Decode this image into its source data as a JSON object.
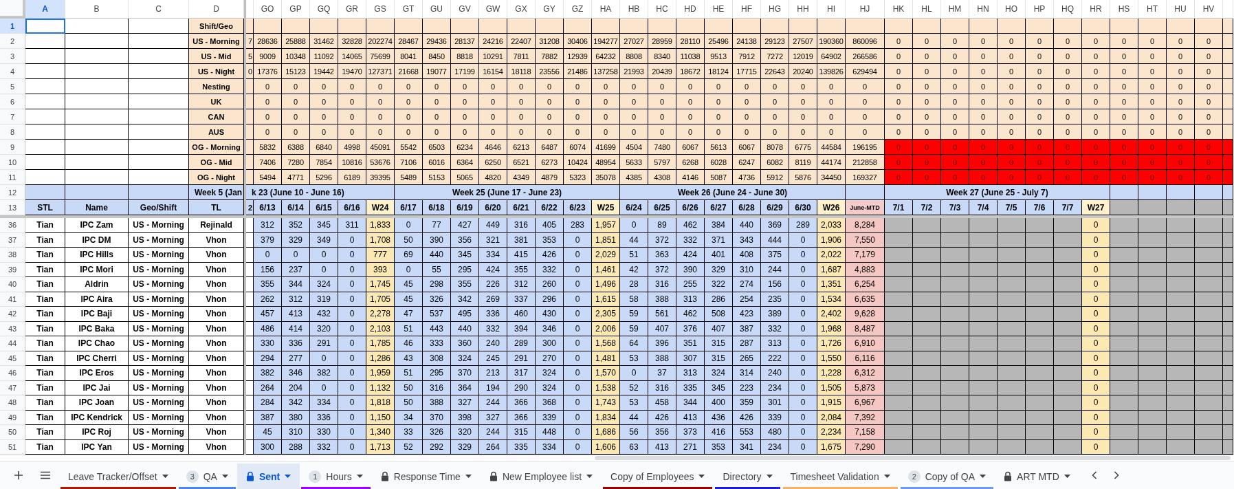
{
  "column_headers": [
    {
      "label": "A",
      "selected": true
    },
    {
      "label": "B",
      "selected": false
    },
    {
      "label": "C",
      "selected": false
    },
    {
      "label": "D",
      "selected": false
    },
    {
      "label": "GO",
      "selected": false
    },
    {
      "label": "GP",
      "selected": false
    },
    {
      "label": "GQ",
      "selected": false
    },
    {
      "label": "GR",
      "selected": false
    },
    {
      "label": "GS",
      "selected": false
    },
    {
      "label": "GT",
      "selected": false
    },
    {
      "label": "GU",
      "selected": false
    },
    {
      "label": "GV",
      "selected": false
    },
    {
      "label": "GW",
      "selected": false
    },
    {
      "label": "GX",
      "selected": false
    },
    {
      "label": "GY",
      "selected": false
    },
    {
      "label": "GZ",
      "selected": false
    },
    {
      "label": "HA",
      "selected": false
    },
    {
      "label": "HB",
      "selected": false
    },
    {
      "label": "HC",
      "selected": false
    },
    {
      "label": "HD",
      "selected": false
    },
    {
      "label": "HE",
      "selected": false
    },
    {
      "label": "HF",
      "selected": false
    },
    {
      "label": "HG",
      "selected": false
    },
    {
      "label": "HH",
      "selected": false
    },
    {
      "label": "HI",
      "selected": false
    },
    {
      "label": "HJ",
      "selected": false
    },
    {
      "label": "HK",
      "selected": false
    },
    {
      "label": "HL",
      "selected": false
    },
    {
      "label": "HM",
      "selected": false
    },
    {
      "label": "HN",
      "selected": false
    },
    {
      "label": "HO",
      "selected": false
    },
    {
      "label": "HP",
      "selected": false
    },
    {
      "label": "HQ",
      "selected": false
    },
    {
      "label": "HR",
      "selected": false
    },
    {
      "label": "HS",
      "selected": false
    },
    {
      "label": "HT",
      "selected": false
    },
    {
      "label": "HU",
      "selected": false
    },
    {
      "label": "HV",
      "selected": false
    }
  ],
  "summary_rows": [
    {
      "number": "1",
      "selected": true,
      "label": "Shift/Geo",
      "flagged": false
    },
    {
      "number": "2",
      "selected": false,
      "label": "US - Morning",
      "cut": "7",
      "flagged": false,
      "values": [
        "28636",
        "25888",
        "31462",
        "32828",
        "202274",
        "28467",
        "29436",
        "28137",
        "24216",
        "22407",
        "31208",
        "30406",
        "194277",
        "27027",
        "28959",
        "28110",
        "25496",
        "24138",
        "29123",
        "27507",
        "190360",
        "860096"
      ],
      "next": [
        "0",
        "0",
        "0",
        "0",
        "0",
        "0",
        "0",
        "0",
        "0",
        "0",
        "0",
        "0"
      ]
    },
    {
      "number": "3",
      "selected": false,
      "label": "US - Mid",
      "cut": "5",
      "flagged": false,
      "values": [
        "9009",
        "10348",
        "11092",
        "14065",
        "75699",
        "8041",
        "8450",
        "8818",
        "10291",
        "7811",
        "7882",
        "12939",
        "64232",
        "8808",
        "8340",
        "11038",
        "9513",
        "7912",
        "7272",
        "12019",
        "64902",
        "266586"
      ],
      "next": [
        "0",
        "0",
        "0",
        "0",
        "0",
        "0",
        "0",
        "0",
        "0",
        "0",
        "0",
        "0"
      ]
    },
    {
      "number": "4",
      "selected": false,
      "label": "US - Night",
      "cut": "0",
      "flagged": false,
      "values": [
        "17376",
        "15123",
        "19442",
        "19470",
        "127371",
        "21668",
        "19077",
        "17199",
        "16154",
        "18118",
        "23556",
        "21486",
        "137258",
        "21993",
        "20439",
        "18672",
        "18124",
        "17715",
        "22643",
        "20240",
        "139826",
        "629494"
      ],
      "next": [
        "0",
        "0",
        "0",
        "0",
        "0",
        "0",
        "0",
        "0",
        "0",
        "0",
        "0",
        "0"
      ]
    },
    {
      "number": "5",
      "selected": false,
      "label": "Nesting",
      "flagged": false,
      "values": [
        "0",
        "0",
        "0",
        "0",
        "0",
        "0",
        "0",
        "0",
        "0",
        "0",
        "0",
        "0",
        "0",
        "0",
        "0",
        "0",
        "0",
        "0",
        "0",
        "0",
        "0",
        "0"
      ],
      "next": [
        "0",
        "0",
        "0",
        "0",
        "0",
        "0",
        "0",
        "0",
        "0",
        "0",
        "0",
        "0"
      ]
    },
    {
      "number": "6",
      "selected": false,
      "label": "UK",
      "flagged": false,
      "values": [
        "0",
        "0",
        "0",
        "0",
        "0",
        "0",
        "0",
        "0",
        "0",
        "0",
        "0",
        "0",
        "0",
        "0",
        "0",
        "0",
        "0",
        "0",
        "0",
        "0",
        "0",
        "0"
      ],
      "next": [
        "0",
        "0",
        "0",
        "0",
        "0",
        "0",
        "0",
        "0",
        "0",
        "0",
        "0",
        "0"
      ]
    },
    {
      "number": "7",
      "selected": false,
      "label": "CAN",
      "flagged": false,
      "values": [
        "0",
        "0",
        "0",
        "0",
        "0",
        "0",
        "0",
        "0",
        "0",
        "0",
        "0",
        "0",
        "0",
        "0",
        "0",
        "0",
        "0",
        "0",
        "0",
        "0",
        "0",
        "0"
      ],
      "next": [
        "0",
        "0",
        "0",
        "0",
        "0",
        "0",
        "0",
        "0",
        "0",
        "0",
        "0",
        "0"
      ]
    },
    {
      "number": "8",
      "selected": false,
      "label": "AUS",
      "flagged": false,
      "values": [
        "0",
        "0",
        "0",
        "0",
        "0",
        "0",
        "0",
        "0",
        "0",
        "0",
        "0",
        "0",
        "0",
        "0",
        "0",
        "0",
        "0",
        "0",
        "0",
        "0",
        "0",
        "0"
      ],
      "next": [
        "0",
        "0",
        "0",
        "0",
        "0",
        "0",
        "0",
        "0",
        "0",
        "0",
        "0",
        "0"
      ]
    },
    {
      "number": "9",
      "selected": false,
      "label": "OG - Morning",
      "flagged": true,
      "values": [
        "5832",
        "6388",
        "6840",
        "4998",
        "45091",
        "5542",
        "6503",
        "6234",
        "4646",
        "6213",
        "6487",
        "6074",
        "41699",
        "4504",
        "7480",
        "6067",
        "5613",
        "6067",
        "8078",
        "6775",
        "44584",
        "196195"
      ],
      "next": [
        "0",
        "0",
        "0",
        "0",
        "0",
        "0",
        "0",
        "0",
        "0",
        "0",
        "0",
        "0"
      ]
    },
    {
      "number": "10",
      "selected": false,
      "label": "OG - Mid",
      "flagged": true,
      "values": [
        "7406",
        "7280",
        "7854",
        "10816",
        "53676",
        "7106",
        "6016",
        "6364",
        "6250",
        "6521",
        "6273",
        "10424",
        "48954",
        "5633",
        "5797",
        "6268",
        "6028",
        "6247",
        "6082",
        "8119",
        "44174",
        "212858"
      ],
      "next": [
        "0",
        "0",
        "0",
        "0",
        "0",
        "0",
        "0",
        "0",
        "0",
        "0",
        "0",
        "0"
      ]
    },
    {
      "number": "11",
      "selected": false,
      "label": "OG - Night",
      "flagged": true,
      "values": [
        "5494",
        "4771",
        "5296",
        "6189",
        "39395",
        "5489",
        "5153",
        "5065",
        "4820",
        "4349",
        "4879",
        "5323",
        "35078",
        "4385",
        "4308",
        "4146",
        "5087",
        "4736",
        "5912",
        "5876",
        "34450",
        "169327"
      ],
      "next": [
        "0",
        "0",
        "0",
        "0",
        "0",
        "0",
        "0",
        "0",
        "0",
        "0",
        "0",
        "0"
      ]
    }
  ],
  "week_row": {
    "number": "12",
    "selected": false,
    "labels": [
      "Week 5 (Jan",
      "k 23 (June 10 - June 16)",
      "Week 25 (June 17 - June 23)",
      "Week 26 (June 24 - June 30)",
      "Week 27 (June 25 - July 7)"
    ]
  },
  "header_row": {
    "number": "13",
    "selected": false,
    "labels": [
      "STL",
      "Name",
      "Geo/Shift",
      "TL"
    ],
    "cut": "2",
    "columns": [
      {
        "label": "6/13",
        "kind": "day"
      },
      {
        "label": "6/14",
        "kind": "day"
      },
      {
        "label": "6/15",
        "kind": "day"
      },
      {
        "label": "6/16",
        "kind": "day"
      },
      {
        "label": "W24",
        "kind": "week_total"
      },
      {
        "label": "6/17",
        "kind": "day"
      },
      {
        "label": "6/18",
        "kind": "day"
      },
      {
        "label": "6/19",
        "kind": "day"
      },
      {
        "label": "6/20",
        "kind": "day"
      },
      {
        "label": "6/21",
        "kind": "day"
      },
      {
        "label": "6/22",
        "kind": "day"
      },
      {
        "label": "6/23",
        "kind": "day"
      },
      {
        "label": "W25",
        "kind": "week_total"
      },
      {
        "label": "6/24",
        "kind": "day"
      },
      {
        "label": "6/25",
        "kind": "day"
      },
      {
        "label": "6/26",
        "kind": "day"
      },
      {
        "label": "6/27",
        "kind": "day"
      },
      {
        "label": "6/28",
        "kind": "day"
      },
      {
        "label": "6/29",
        "kind": "day"
      },
      {
        "label": "6/30",
        "kind": "day"
      },
      {
        "label": "W26",
        "kind": "week_total"
      },
      {
        "label": "June-MTD",
        "kind": "month_total"
      },
      {
        "label": "7/1",
        "kind": "future_day"
      },
      {
        "label": "7/2",
        "kind": "future_day"
      },
      {
        "label": "7/3",
        "kind": "future_day"
      },
      {
        "label": "7/4",
        "kind": "future_day"
      },
      {
        "label": "7/5",
        "kind": "future_day"
      },
      {
        "label": "7/6",
        "kind": "future_day"
      },
      {
        "label": "7/7",
        "kind": "future_day"
      },
      {
        "label": "W27",
        "kind": "week_total"
      }
    ]
  },
  "rows": [
    {
      "number": "36",
      "selected": false,
      "stl": "Tian",
      "name": "IPC Zam",
      "geo": "US - Morning",
      "tl": "Rejinald",
      "values": [
        "312",
        "352",
        "345",
        "311",
        "1,833",
        "0",
        "77",
        "427",
        "449",
        "316",
        "405",
        "283",
        "1,957",
        "0",
        "89",
        "462",
        "384",
        "440",
        "369",
        "289",
        "2,033",
        "8,284",
        "0"
      ]
    },
    {
      "number": "37",
      "selected": false,
      "stl": "Tian",
      "name": "IPC DM",
      "geo": "US - Morning",
      "tl": "Vhon",
      "values": [
        "379",
        "329",
        "349",
        "0",
        "1,708",
        "50",
        "390",
        "356",
        "321",
        "381",
        "353",
        "0",
        "1,851",
        "44",
        "372",
        "332",
        "371",
        "343",
        "444",
        "0",
        "1,906",
        "7,550",
        "0"
      ]
    },
    {
      "number": "38",
      "selected": false,
      "stl": "Tian",
      "name": "IPC Hills",
      "geo": "US - Morning",
      "tl": "Vhon",
      "values": [
        "0",
        "0",
        "0",
        "0",
        "777",
        "69",
        "440",
        "345",
        "334",
        "415",
        "426",
        "0",
        "2,029",
        "51",
        "363",
        "424",
        "401",
        "408",
        "375",
        "0",
        "2,022",
        "7,179",
        "0"
      ]
    },
    {
      "number": "39",
      "selected": false,
      "stl": "Tian",
      "name": "IPC Mori",
      "geo": "US - Morning",
      "tl": "Vhon",
      "values": [
        "156",
        "237",
        "0",
        "0",
        "393",
        "0",
        "55",
        "295",
        "424",
        "355",
        "332",
        "0",
        "1,461",
        "42",
        "372",
        "390",
        "329",
        "310",
        "244",
        "0",
        "1,687",
        "4,883",
        "0"
      ]
    },
    {
      "number": "40",
      "selected": false,
      "stl": "Tian",
      "name": "Aldrin",
      "geo": "US - Morning",
      "tl": "Vhon",
      "values": [
        "355",
        "344",
        "324",
        "0",
        "1,745",
        "45",
        "298",
        "355",
        "226",
        "312",
        "260",
        "0",
        "1,496",
        "28",
        "316",
        "255",
        "322",
        "274",
        "156",
        "0",
        "1,351",
        "6,254",
        "0"
      ]
    },
    {
      "number": "41",
      "selected": false,
      "stl": "Tian",
      "name": "IPC Aira",
      "geo": "US - Morning",
      "tl": "Vhon",
      "values": [
        "262",
        "312",
        "319",
        "0",
        "1,705",
        "45",
        "326",
        "342",
        "269",
        "337",
        "296",
        "0",
        "1,615",
        "58",
        "388",
        "313",
        "286",
        "254",
        "235",
        "0",
        "1,534",
        "6,635",
        "0"
      ]
    },
    {
      "number": "42",
      "selected": false,
      "stl": "Tian",
      "name": "IPC Baji",
      "geo": "US - Morning",
      "tl": "Vhon",
      "values": [
        "457",
        "413",
        "432",
        "0",
        "2,278",
        "47",
        "537",
        "495",
        "336",
        "460",
        "430",
        "0",
        "2,305",
        "59",
        "561",
        "462",
        "508",
        "423",
        "389",
        "0",
        "2,402",
        "9,628",
        "0"
      ]
    },
    {
      "number": "43",
      "selected": false,
      "stl": "Tian",
      "name": "IPC Baka",
      "geo": "US - Morning",
      "tl": "Vhon",
      "values": [
        "486",
        "414",
        "320",
        "0",
        "2,103",
        "51",
        "443",
        "440",
        "332",
        "394",
        "346",
        "0",
        "2,006",
        "59",
        "407",
        "376",
        "407",
        "387",
        "332",
        "0",
        "1,968",
        "8,487",
        "0"
      ]
    },
    {
      "number": "44",
      "selected": false,
      "stl": "Tian",
      "name": "IPC Chao",
      "geo": "US - Morning",
      "tl": "Vhon",
      "values": [
        "330",
        "336",
        "291",
        "0",
        "1,785",
        "46",
        "333",
        "360",
        "240",
        "289",
        "300",
        "0",
        "1,568",
        "64",
        "396",
        "351",
        "315",
        "287",
        "313",
        "0",
        "1,726",
        "6,910",
        "0"
      ]
    },
    {
      "number": "45",
      "selected": false,
      "stl": "Tian",
      "name": "IPC Cherri",
      "geo": "US - Morning",
      "tl": "Vhon",
      "values": [
        "294",
        "277",
        "0",
        "0",
        "1,286",
        "43",
        "308",
        "324",
        "245",
        "291",
        "270",
        "0",
        "1,481",
        "53",
        "388",
        "307",
        "315",
        "265",
        "222",
        "0",
        "1,550",
        "6,116",
        "0"
      ]
    },
    {
      "number": "46",
      "selected": false,
      "stl": "Tian",
      "name": "IPC Eros",
      "geo": "US - Morning",
      "tl": "Vhon",
      "values": [
        "382",
        "346",
        "382",
        "0",
        "1,959",
        "51",
        "295",
        "370",
        "213",
        "317",
        "324",
        "0",
        "1,570",
        "0",
        "37",
        "313",
        "324",
        "314",
        "240",
        "0",
        "1,228",
        "6,312",
        "0"
      ]
    },
    {
      "number": "47",
      "selected": false,
      "stl": "Tian",
      "name": "IPC Jai",
      "geo": "US - Morning",
      "tl": "Vhon",
      "values": [
        "264",
        "204",
        "0",
        "0",
        "1,132",
        "50",
        "316",
        "364",
        "194",
        "290",
        "324",
        "0",
        "1,538",
        "52",
        "316",
        "335",
        "345",
        "223",
        "234",
        "0",
        "1,505",
        "5,873",
        "0"
      ]
    },
    {
      "number": "48",
      "selected": false,
      "stl": "Tian",
      "name": "IPC Joan",
      "geo": "US - Morning",
      "tl": "Vhon",
      "values": [
        "284",
        "342",
        "334",
        "0",
        "1,818",
        "50",
        "388",
        "327",
        "244",
        "366",
        "368",
        "0",
        "1,743",
        "53",
        "458",
        "344",
        "400",
        "359",
        "301",
        "0",
        "1,915",
        "6,967",
        "0"
      ]
    },
    {
      "number": "49",
      "selected": false,
      "stl": "Tian",
      "name": "IPC Kendrick",
      "geo": "US - Morning",
      "tl": "Vhon",
      "values": [
        "387",
        "380",
        "336",
        "0",
        "1,150",
        "34",
        "370",
        "398",
        "327",
        "366",
        "339",
        "0",
        "1,834",
        "44",
        "426",
        "413",
        "436",
        "426",
        "339",
        "0",
        "2,084",
        "7,392",
        "0"
      ]
    },
    {
      "number": "50",
      "selected": false,
      "stl": "Tian",
      "name": "IPC Roj",
      "geo": "US - Morning",
      "tl": "Vhon",
      "values": [
        "45",
        "310",
        "330",
        "0",
        "1,340",
        "33",
        "326",
        "320",
        "244",
        "315",
        "448",
        "0",
        "1,686",
        "56",
        "356",
        "373",
        "416",
        "553",
        "480",
        "0",
        "2,234",
        "7,158",
        "0"
      ]
    },
    {
      "number": "51",
      "selected": false,
      "stl": "Tian",
      "name": "IPC Yan",
      "geo": "US - Morning",
      "tl": "Vhon",
      "values": [
        "300",
        "288",
        "332",
        "0",
        "1,713",
        "52",
        "292",
        "329",
        "264",
        "335",
        "334",
        "0",
        "1,606",
        "63",
        "413",
        "271",
        "353",
        "341",
        "234",
        "0",
        "1,675",
        "7,290",
        "0"
      ]
    }
  ],
  "tabs": [
    {
      "label": "Leave Tracker/Offset",
      "selected": false,
      "locked": false,
      "color": "#a61c00"
    },
    {
      "label": "QA",
      "selected": false,
      "locked": false,
      "badge": "3",
      "color": "#4a86e8"
    },
    {
      "label": "Sent",
      "selected": true,
      "locked": true
    },
    {
      "label": "Hours",
      "selected": false,
      "locked": false,
      "badge": "1",
      "color": "#9900ff"
    },
    {
      "label": "Response Time",
      "selected": false,
      "locked": true
    },
    {
      "label": "New Employee list",
      "selected": false,
      "locked": true
    },
    {
      "label": "Copy of Employees",
      "selected": false,
      "locked": false,
      "color": "#990000"
    },
    {
      "label": "Directory",
      "selected": false,
      "locked": false,
      "color": "#1c1cd9"
    },
    {
      "label": "Timesheet Validation",
      "selected": false,
      "locked": false,
      "color": "#f6b26b"
    },
    {
      "label": "Copy of QA",
      "selected": false,
      "locked": false,
      "badge": "2",
      "color": "#6d9eeb"
    },
    {
      "label": "ART MTD",
      "selected": false,
      "locked": true
    }
  ]
}
